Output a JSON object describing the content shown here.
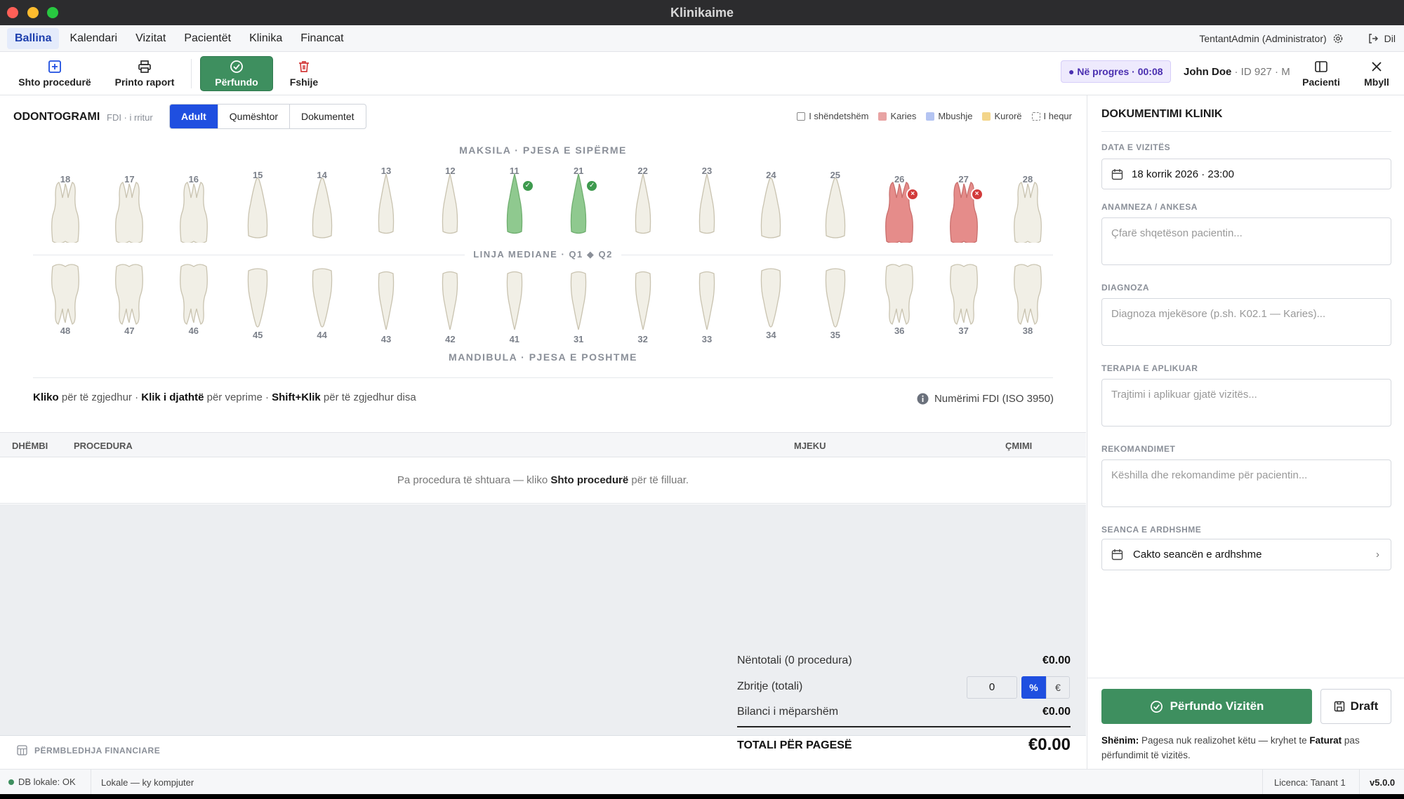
{
  "window": {
    "title": "Klinikaime"
  },
  "menu": {
    "items": [
      "Ballina",
      "Kalendari",
      "Vizitat",
      "Pacientët",
      "Klinika",
      "Financat"
    ],
    "user": "TentantAdmin (Administrator)",
    "logout": "Dil"
  },
  "toolbar": {
    "add": "Shto procedurë",
    "print": "Printo raport",
    "finish": "Përfundo",
    "delete": "Fshije",
    "status": "Në progres · 00:08",
    "patient_name": "John Doe",
    "patient_meta": "· ID 927 · M",
    "patient_btn": "Pacienti",
    "close_btn": "Mbyll"
  },
  "odonto": {
    "title": "ODONTOGRAMI",
    "subtitle": "FDI · i rritur",
    "tabs": [
      "Adult",
      "Qumështor",
      "Dokumentet"
    ],
    "legend": [
      "I shëndetshëm",
      "Karies",
      "Mbushje",
      "Kurorë",
      "I hequr"
    ],
    "upper_label": "MAKSILA · PJESA E SIPËRME",
    "mid_label": "LINJA MEDIANE · Q1 ◆ Q2",
    "lower_label": "MANDIBULA · PJESA E POSHTME",
    "upper": [
      "18",
      "17",
      "16",
      "15",
      "14",
      "13",
      "12",
      "11",
      "21",
      "22",
      "23",
      "24",
      "25",
      "26",
      "27",
      "28"
    ],
    "lower": [
      "48",
      "47",
      "46",
      "45",
      "44",
      "43",
      "42",
      "41",
      "31",
      "32",
      "33",
      "34",
      "35",
      "36",
      "37",
      "38"
    ],
    "hint_b1": "Kliko",
    "hint_t1": " për të zgjedhur · ",
    "hint_b2": "Klik i djathtë",
    "hint_t2": " për veprime · ",
    "hint_b3": "Shift+Klik",
    "hint_t3": " për të zgjedhur disa",
    "fdi": "Numërimi FDI (ISO 3950)"
  },
  "colors": {
    "healthy": "#f1efe6",
    "caries": "#e58c8a",
    "filling": "#a9bdf0",
    "crown": "#f3d58a",
    "green": "#8fc98f",
    "accent": "#1f4fe0",
    "finish": "#3e8f5f"
  },
  "table": {
    "headers": [
      "DHËMBI",
      "PROCEDURA",
      "MJEKU",
      "ÇMIMI"
    ],
    "empty_pre": "Pa procedura të shtuara — kliko ",
    "empty_b": "Shto procedurë",
    "empty_post": " për të filluar."
  },
  "totals": {
    "subtotal_label": "Nëntotali (0 procedura)",
    "subtotal": "€0.00",
    "discount_label": "Zbritje (totali)",
    "discount_value": "0",
    "pct": "%",
    "eur": "€",
    "prev_label": "Bilanci i mëparshëm",
    "prev": "€0.00",
    "total_label": "TOTALI PËR PAGESË",
    "total": "€0.00",
    "summary": "PËRMBLEDHJA FINANCIARE"
  },
  "doc": {
    "title": "DOKUMENTIMI KLINIK",
    "date_label": "DATA E VIZITËS",
    "date": "18 korrik 2026 · 23:00",
    "anam_label": "ANAMNEZA / ANKESA",
    "anam_ph": "Çfarë shqetëson pacientin...",
    "diag_label": "DIAGNOZA",
    "diag_ph": "Diagnoza mjekësore (p.sh. K02.1 — Karies)...",
    "ther_label": "TERAPIA E APLIKUAR",
    "ther_ph": "Trajtimi i aplikuar gjatë vizitës...",
    "rec_label": "REKOMANDIMET",
    "rec_ph": "Këshilla dhe rekomandime për pacientin...",
    "next_label": "SEANCA E ARDHSHME",
    "next_btn": "Cakto seancën e ardhshme",
    "finish_btn": "Përfundo Vizitën",
    "draft_btn": "Draft",
    "note_b1": "Shënim:",
    "note_t1": " Pagesa nuk realizohet këtu — kryhet te ",
    "note_b2": "Faturat",
    "note_t2": " pas përfundimit të vizitës."
  },
  "footer": {
    "db": "DB lokale: OK",
    "local": "Lokale — ky kompjuter",
    "license": "Licenca: Tanant 1",
    "version": "v5.0.0"
  }
}
